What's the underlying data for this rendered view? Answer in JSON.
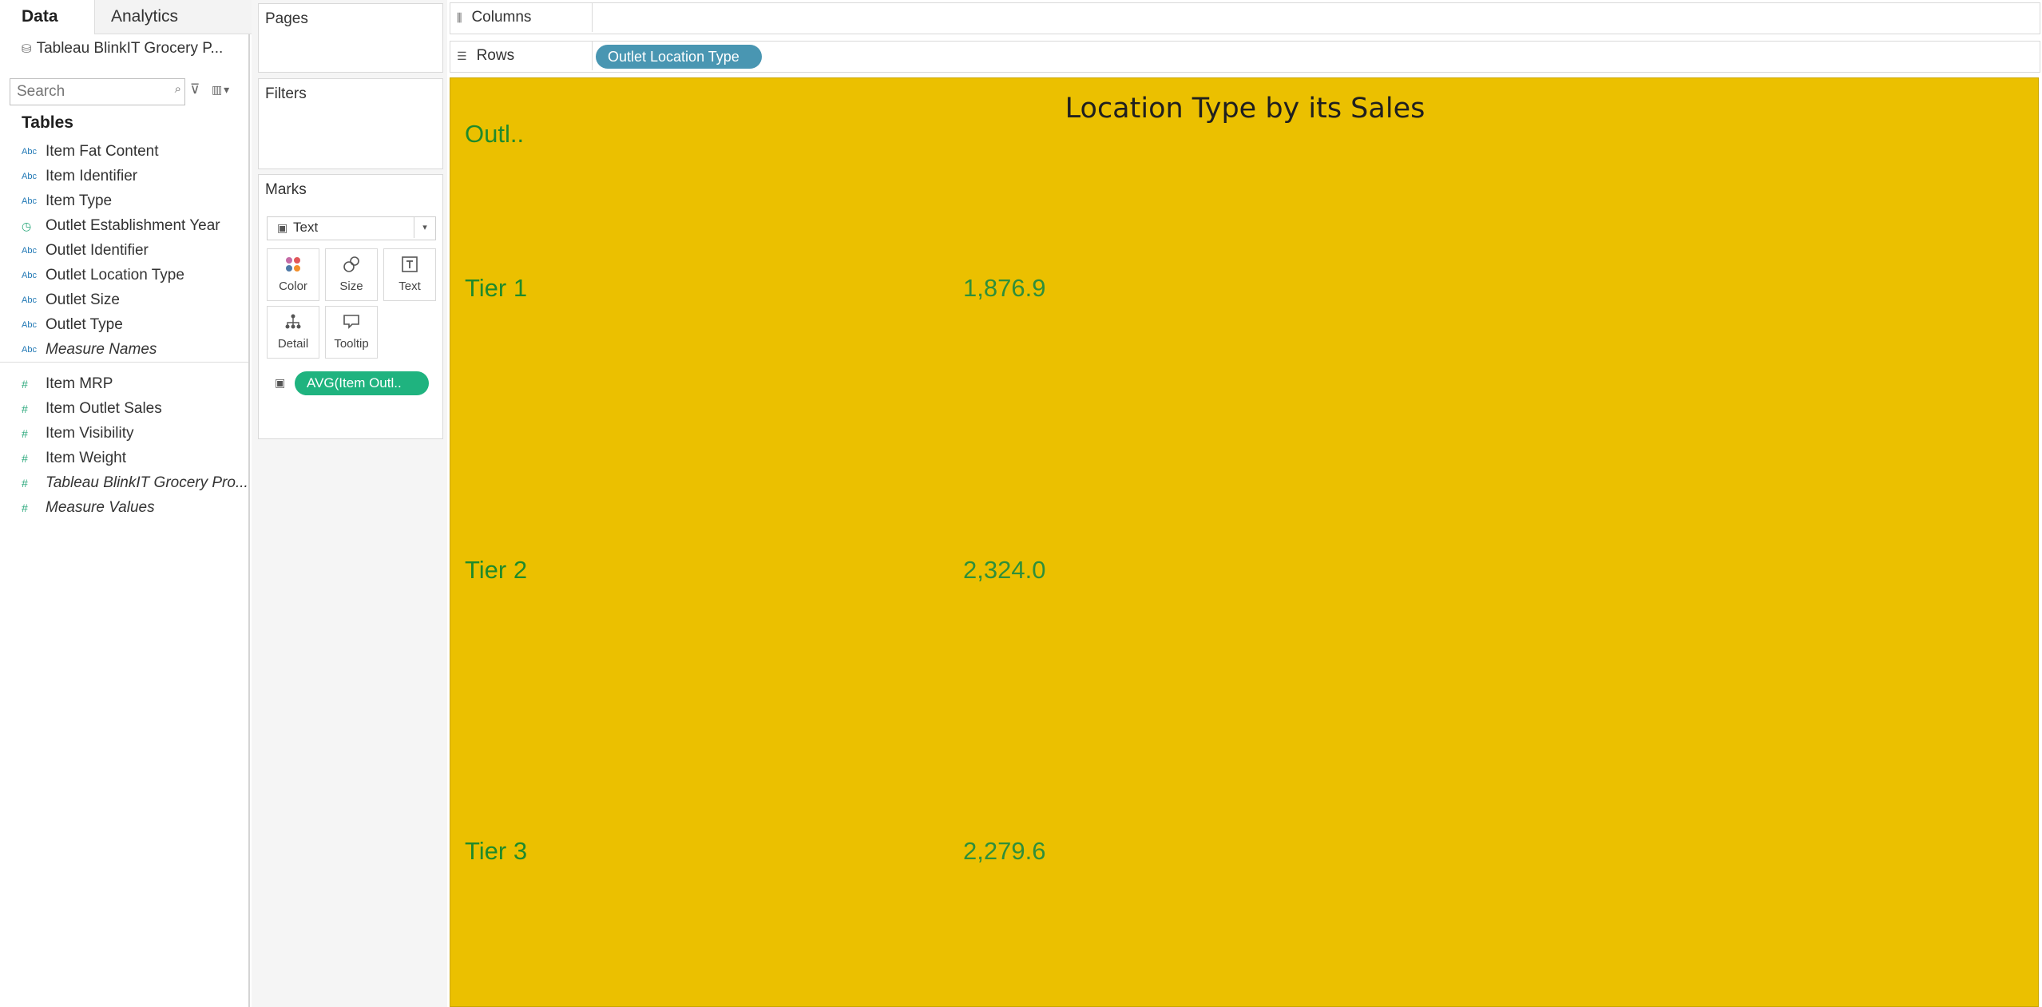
{
  "left_pane": {
    "tabs": [
      "Data",
      "Analytics"
    ],
    "datasource": "Tableau BlinkIT Grocery P...",
    "search_placeholder": "Search",
    "tables_header": "Tables",
    "dimensions": [
      {
        "type": "abc",
        "label": "Item Fat Content",
        "italic": false
      },
      {
        "type": "abc",
        "label": "Item Identifier",
        "italic": false
      },
      {
        "type": "abc",
        "label": "Item Type",
        "italic": false
      },
      {
        "type": "date",
        "label": "Outlet Establishment Year",
        "italic": false
      },
      {
        "type": "abc",
        "label": "Outlet Identifier",
        "italic": false
      },
      {
        "type": "abc",
        "label": "Outlet Location Type",
        "italic": false
      },
      {
        "type": "abc",
        "label": "Outlet Size",
        "italic": false
      },
      {
        "type": "abc",
        "label": "Outlet Type",
        "italic": false
      },
      {
        "type": "abc",
        "label": "Measure Names",
        "italic": true
      }
    ],
    "measures": [
      {
        "type": "num",
        "label": "Item MRP",
        "italic": false
      },
      {
        "type": "num",
        "label": "Item Outlet Sales",
        "italic": false
      },
      {
        "type": "num",
        "label": "Item Visibility",
        "italic": false
      },
      {
        "type": "num",
        "label": "Item Weight",
        "italic": false
      },
      {
        "type": "num",
        "label": "Tableau BlinkIT Grocery Pro...",
        "italic": true
      },
      {
        "type": "num",
        "label": "Measure Values",
        "italic": true
      }
    ]
  },
  "cards": {
    "pages": "Pages",
    "filters": "Filters",
    "marks": "Marks",
    "mark_type": "Text",
    "mark_buttons": [
      "Color",
      "Size",
      "Text",
      "Detail",
      "Tooltip"
    ],
    "mark_pill": "AVG(Item Outl.."
  },
  "shelves": {
    "columns_label": "Columns",
    "rows_label": "Rows",
    "rows_pill": "Outlet Location Type"
  },
  "viz": {
    "title": "Location Type by its Sales",
    "clipped_header": "Outl..",
    "rows": [
      {
        "label": "Tier 1",
        "value": "1,876.9"
      },
      {
        "label": "Tier 2",
        "value": "2,324.0"
      },
      {
        "label": "Tier 3",
        "value": "2,279.6"
      }
    ],
    "background_color": "#ebc000",
    "text_color": "#1f8a2b"
  },
  "colors": {
    "dimension_pill": "#4996b2",
    "measure_pill": "#1fb37f"
  }
}
